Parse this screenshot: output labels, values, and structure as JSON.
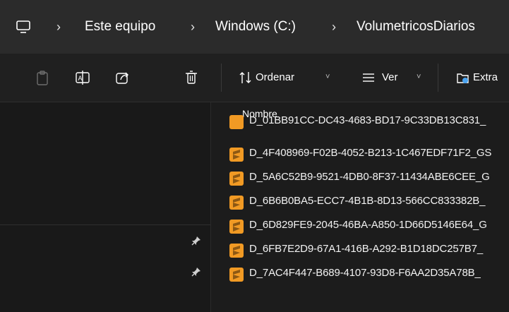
{
  "breadcrumb": {
    "items": [
      "Este equipo",
      "Windows (C:)",
      "VolumetricosDiarios"
    ]
  },
  "toolbar": {
    "sort_label": "Ordenar",
    "view_label": "Ver",
    "extract_label": "Extra"
  },
  "file_list": {
    "column_name": "Nombre",
    "cut_row_fragment": "D_01BB91CC-DC43-4683-BD17-9C33DB13C831_",
    "files": [
      "D_4F408969-F02B-4052-B213-1C467EDF71F2_GS",
      "D_5A6C52B9-9521-4DB0-8F37-11434ABE6CEE_G",
      "D_6B6B0BA5-ECC7-4B1B-8D13-566CC833382B_",
      "D_6D829FE9-2045-46BA-A850-1D66D5146E64_G",
      "D_6FB7E2D9-67A1-416B-A292-B1D18DC257B7_",
      "D_7AC4F447-B689-4107-93D8-F6AA2D35A78B_"
    ]
  },
  "colors": {
    "file_icon": "#f19a24",
    "background": "#1c1c1c",
    "toolbar": "#202020",
    "addressbar": "#2b2b2b"
  },
  "icons": [
    "computer-icon",
    "paste-icon",
    "rename-icon",
    "share-icon",
    "delete-icon",
    "sort-icon",
    "view-icon",
    "extract-icon",
    "pin-icon",
    "sublime-file-icon"
  ]
}
